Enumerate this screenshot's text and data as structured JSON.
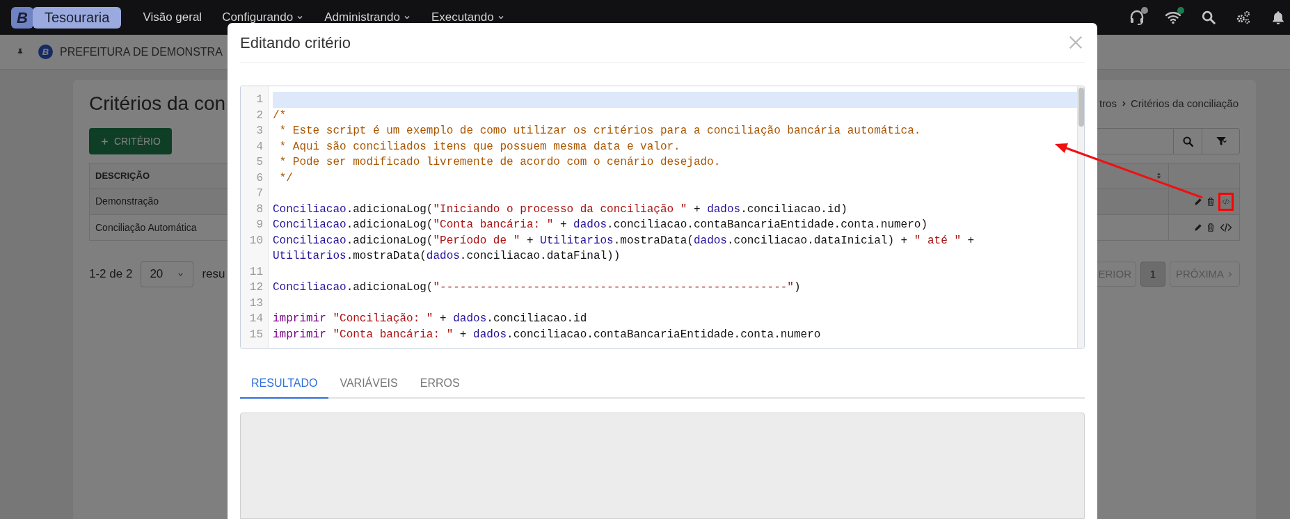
{
  "navbar": {
    "logo_letter": "B",
    "app_name": "Tesouraria",
    "menu": [
      {
        "label": "Visão geral",
        "dropdown": false
      },
      {
        "label": "Configurando",
        "dropdown": true
      },
      {
        "label": "Administrando",
        "dropdown": true
      },
      {
        "label": "Executando",
        "dropdown": true
      }
    ],
    "status_icons": [
      {
        "kind": "headset",
        "color": "#8a8a8a"
      },
      {
        "kind": "wifi",
        "color": "#1f7a4d"
      }
    ],
    "tool_icons": [
      {
        "kind": "search"
      },
      {
        "kind": "gears"
      },
      {
        "kind": "bell"
      }
    ]
  },
  "subbar": {
    "org_letter": "B",
    "org_name": "PREFEITURA DE DEMONSTRA"
  },
  "page": {
    "title": "Critérios da con",
    "breadcrumb": [
      "tros",
      "Critérios da conciliação"
    ],
    "add_button": "CRITÉRIO",
    "table": {
      "header": "DESCRIÇÃO",
      "rows": [
        {
          "description": "Demonstração",
          "highlighted": true
        },
        {
          "description": "Conciliação Automática",
          "highlighted": false
        }
      ]
    },
    "pagination": {
      "range": "1-2 de 2",
      "page_size": "20",
      "suffix": "resu",
      "previous": "ERIOR",
      "pages": [
        {
          "label": "1",
          "selected": true
        }
      ],
      "next": "PRÓXIMA"
    }
  },
  "modal": {
    "title": "Editando critério",
    "editor": {
      "lines": [
        {
          "number": "1",
          "active": true
        },
        {
          "number": "2",
          "active": false,
          "tokens": [
            {
              "kind": "comment",
              "text": "/*"
            }
          ]
        },
        {
          "number": "3",
          "active": false,
          "tokens": [
            {
              "kind": "comment",
              "text": " * Este script é um exemplo de como utilizar os critérios para a conciliação bancária automática."
            }
          ]
        },
        {
          "number": "4",
          "active": false,
          "tokens": [
            {
              "kind": "comment",
              "text": " * Aqui são conciliados itens que possuem mesma data e valor."
            }
          ]
        },
        {
          "number": "5",
          "active": false,
          "tokens": [
            {
              "kind": "comment",
              "text": " * Pode ser modificado livremente de acordo com o cenário desejado."
            }
          ]
        },
        {
          "number": "6",
          "active": false,
          "tokens": [
            {
              "kind": "comment",
              "text": " */"
            }
          ]
        },
        {
          "number": "7",
          "active": false
        },
        {
          "number": "8",
          "active": false,
          "tokens": [
            {
              "kind": "variable",
              "text": "Conciliacao"
            },
            {
              "kind": "plain",
              "text": ".adicionaLog("
            },
            {
              "kind": "string",
              "text": "\"Iniciando o processo da conciliação \""
            },
            {
              "kind": "plain",
              "text": " + "
            },
            {
              "kind": "variable",
              "text": "dados"
            },
            {
              "kind": "plain",
              "text": ".conciliacao.id)"
            }
          ]
        },
        {
          "number": "9",
          "active": false,
          "tokens": [
            {
              "kind": "variable",
              "text": "Conciliacao"
            },
            {
              "kind": "plain",
              "text": ".adicionaLog("
            },
            {
              "kind": "string",
              "text": "\"Conta bancária: \""
            },
            {
              "kind": "plain",
              "text": " + "
            },
            {
              "kind": "variable",
              "text": "dados"
            },
            {
              "kind": "plain",
              "text": ".conciliacao.contaBancariaEntidade.conta.numero)"
            }
          ]
        },
        {
          "number": "10",
          "active": false,
          "tokens": [
            {
              "kind": "variable",
              "text": "Conciliacao"
            },
            {
              "kind": "plain",
              "text": ".adicionaLog("
            },
            {
              "kind": "string",
              "text": "\"Período de \""
            },
            {
              "kind": "plain",
              "text": " + "
            },
            {
              "kind": "variable",
              "text": "Utilitarios"
            },
            {
              "kind": "plain",
              "text": ".mostraData("
            },
            {
              "kind": "variable",
              "text": "dados"
            },
            {
              "kind": "plain",
              "text": ".conciliacao.dataInicial) + "
            },
            {
              "kind": "string",
              "text": "\" até \""
            },
            {
              "kind": "plain",
              "text": " + "
            },
            {
              "kind": "variable",
              "text": "Utilitarios"
            },
            {
              "kind": "plain",
              "text": ".mostraData("
            },
            {
              "kind": "variable",
              "text": "dados"
            },
            {
              "kind": "plain",
              "text": ".conciliacao.dataFinal))"
            }
          ]
        },
        {
          "number": "11",
          "active": false
        },
        {
          "number": "12",
          "active": false,
          "tokens": [
            {
              "kind": "variable",
              "text": "Conciliacao"
            },
            {
              "kind": "plain",
              "text": ".adicionaLog("
            },
            {
              "kind": "string",
              "text": "\"----------------------------------------------------\""
            },
            {
              "kind": "plain",
              "text": ")"
            }
          ]
        },
        {
          "number": "13",
          "active": false
        },
        {
          "number": "14",
          "active": false,
          "tokens": [
            {
              "kind": "keyword",
              "text": "imprimir "
            },
            {
              "kind": "string",
              "text": "\"Conciliação: \""
            },
            {
              "kind": "plain",
              "text": " + "
            },
            {
              "kind": "variable",
              "text": "dados"
            },
            {
              "kind": "plain",
              "text": ".conciliacao.id"
            }
          ]
        },
        {
          "number": "15",
          "active": false,
          "tokens": [
            {
              "kind": "keyword",
              "text": "imprimir "
            },
            {
              "kind": "string",
              "text": "\"Conta bancária: \""
            },
            {
              "kind": "plain",
              "text": " + "
            },
            {
              "kind": "variable",
              "text": "dados"
            },
            {
              "kind": "plain",
              "text": ".conciliacao.contaBancariaEntidade.conta.numero"
            }
          ]
        }
      ]
    },
    "tabs": [
      {
        "label": "RESULTADO",
        "selected": true
      },
      {
        "label": "VARIÁVEIS",
        "selected": false
      },
      {
        "label": "ERROS",
        "selected": false
      }
    ]
  },
  "annotation": {
    "kind": "arrow"
  }
}
